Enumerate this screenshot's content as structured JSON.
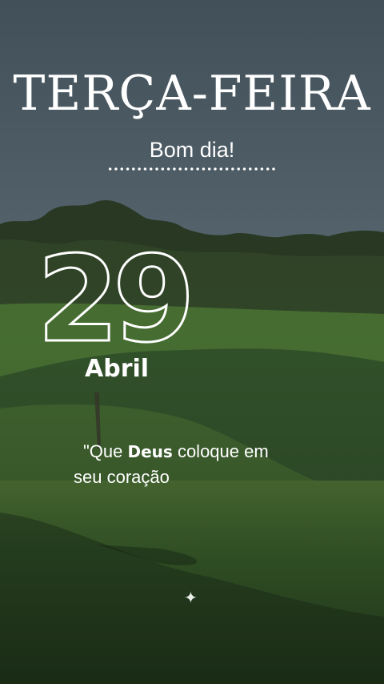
{
  "story": {
    "weekday": "TERÇA-FEIRA",
    "greeting": "Bom dia!",
    "day_number": "29",
    "month": "Abril",
    "quote": {
      "prefix": "\"Que ",
      "highlight": "Deus",
      "suffix": " coloque em",
      "line2": "seu coração"
    },
    "sparkle_icon": "sparkle-icon"
  },
  "colors": {
    "sky_top": "#55656f",
    "sky_bottom": "#7a8b93",
    "foliage": "#2f4a24",
    "lawn": "#3f6b2c",
    "overlay": "#1c2420",
    "text": "#ffffff"
  }
}
